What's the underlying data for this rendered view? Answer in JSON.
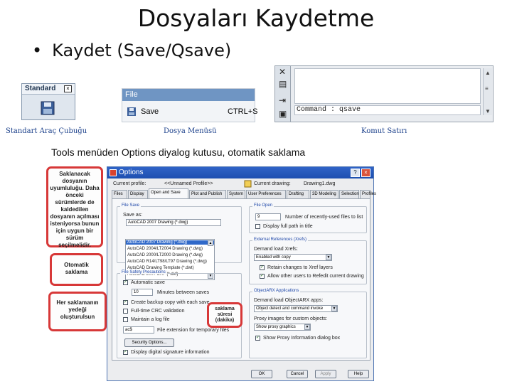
{
  "slide": {
    "title": "Dosyaları Kaydetme",
    "bullet_mark": "•",
    "bullet": "Kaydet (Save/Qsave)",
    "subtitle": "Tools menüden Options diyalog kutusu, otomatik saklama"
  },
  "toolbar": {
    "title": "Standard",
    "close": "×",
    "caption": "Standart Araç Çubuğu"
  },
  "file_menu": {
    "header": "File",
    "item_label": "Save",
    "item_shortcut": "CTRL+S",
    "caption": "Dosya Menüsü"
  },
  "command_line": {
    "prompt": "Command : qsave",
    "caption": "Komut Satırı"
  },
  "callouts": {
    "format": "Saklanacak dosyanın uyumluluğu. Daha önceki sürümlerde de kaldedilen dosyanın açılması isteniyorsa bunun için uygun bir sürüm seçilmelidir.",
    "autosave": "Otomatik saklama",
    "backup": "Her saklamanın yedeği oluşturulsun",
    "interval": "saklama süresi (dakika)"
  },
  "dialog": {
    "title": "Options",
    "help": "?",
    "close": "×",
    "current_profile_label": "Current profile:",
    "current_profile": "<<Unnamed Profile>>",
    "current_drawing_label": "Current drawing:",
    "current_drawing": "Drawing1.dwg",
    "tabs": [
      "Files",
      "Display",
      "Open and Save",
      "Plot and Publish",
      "System",
      "User Preferences",
      "Drafting",
      "3D Modeling",
      "Selection",
      "Profiles"
    ],
    "file_save": {
      "title": "File Save",
      "save_as_label": "Save as:",
      "save_as_value": "AutoCAD 2007 Drawing (*.dwg)",
      "options": [
        "AutoCAD 2007 Drawing (*.dwg)",
        "AutoCAD 2004/LT2004 Drawing (*.dwg)",
        "AutoCAD 2000/LT2000 Drawing (*.dwg)",
        "AutoCAD R14/LT98/LT97 Drawing (*.dwg)",
        "AutoCAD Drawing Template (*.dwt)",
        "AutoCAD 2007 DXF (*.dxf)"
      ]
    },
    "file_safety": {
      "title": "File Safety Precautions",
      "autosave": "Automatic save",
      "minutes_value": "10",
      "minutes_label": "Minutes between saves",
      "backup": "Create backup copy with each save",
      "crc": "Full-time CRC validation",
      "log": "Maintain a log file",
      "ext_value": "ac$",
      "ext_label": "File extension for temporary files",
      "security_button": "Security Options...",
      "digital_sig": "Display digital signature information"
    },
    "file_open": {
      "title": "File Open",
      "recent_value": "9",
      "recent_label": "Number of recently-used files to list",
      "full_path": "Display full path in title"
    },
    "xref": {
      "title": "External References (Xrefs)",
      "demand_label": "Demand load Xrefs:",
      "demand_value": "Enabled with copy",
      "retain": "Retain changes to Xref layers",
      "allow": "Allow other users to Refedit current drawing"
    },
    "arx": {
      "title": "ObjectARX Applications",
      "demand_label": "Demand load ObjectARX apps:",
      "demand_value": "Object detect and command invoke",
      "proxy_label": "Proxy images for custom objects:",
      "proxy_value": "Show proxy graphics",
      "show_dialog": "Show Proxy Information dialog box"
    },
    "buttons": {
      "ok": "OK",
      "cancel": "Cancel",
      "apply": "Apply",
      "help": "Help"
    }
  },
  "colors": {
    "callout_border": "#d73838",
    "caption": "#1a3f8a",
    "dialog_title": "#2f63c7"
  }
}
